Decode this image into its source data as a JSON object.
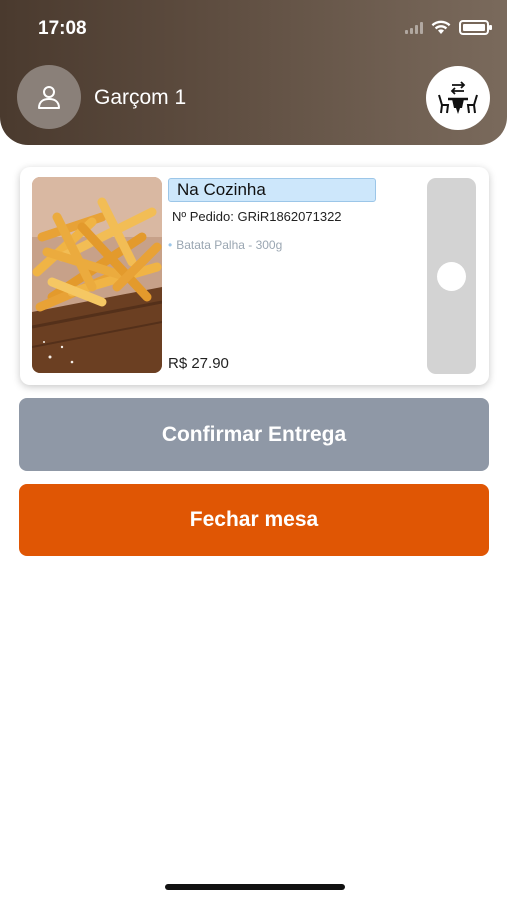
{
  "status_bar": {
    "time": "17:08"
  },
  "header": {
    "waiter_name": "Garçom 1",
    "avatar_icon": "user-icon",
    "table_icon": "table-swap-icon",
    "gradient_colors": [
      "#4a3a2e",
      "#7a6a5c"
    ]
  },
  "order": {
    "status": "Na Cozinha",
    "order_number": "Nº Pedido: GRiR1862071322",
    "items": [
      "Batata Palha - 300g"
    ],
    "price": "R$ 27.90",
    "image_icon": "fries-image",
    "status_color": "#cde7fb"
  },
  "actions": {
    "confirm_label": "Confirmar Entrega",
    "close_label": "Fechar mesa",
    "confirm_color": "#8f98a6",
    "close_color": "#e05604"
  }
}
